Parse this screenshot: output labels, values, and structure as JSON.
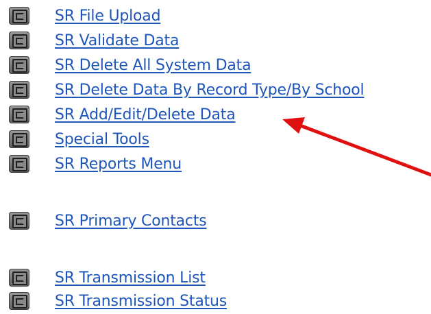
{
  "menu": {
    "items": [
      {
        "label": "SR File Upload"
      },
      {
        "label": "SR Validate Data"
      },
      {
        "label": "SR Delete All System Data"
      },
      {
        "label": "SR Delete Data By Record Type/By School"
      },
      {
        "label": "SR Add/Edit/Delete Data"
      },
      {
        "label": "Special Tools"
      },
      {
        "label": "SR Reports Menu"
      },
      {
        "label": "SR Primary Contacts"
      },
      {
        "label": "SR Transmission List"
      },
      {
        "label": "SR Transmission Status"
      }
    ]
  },
  "annotation": {
    "arrow_color": "#e01010",
    "target": "SR Add/Edit/Delete Data"
  },
  "colors": {
    "link": "#1e55b8",
    "icon": "#6e6e6e"
  }
}
